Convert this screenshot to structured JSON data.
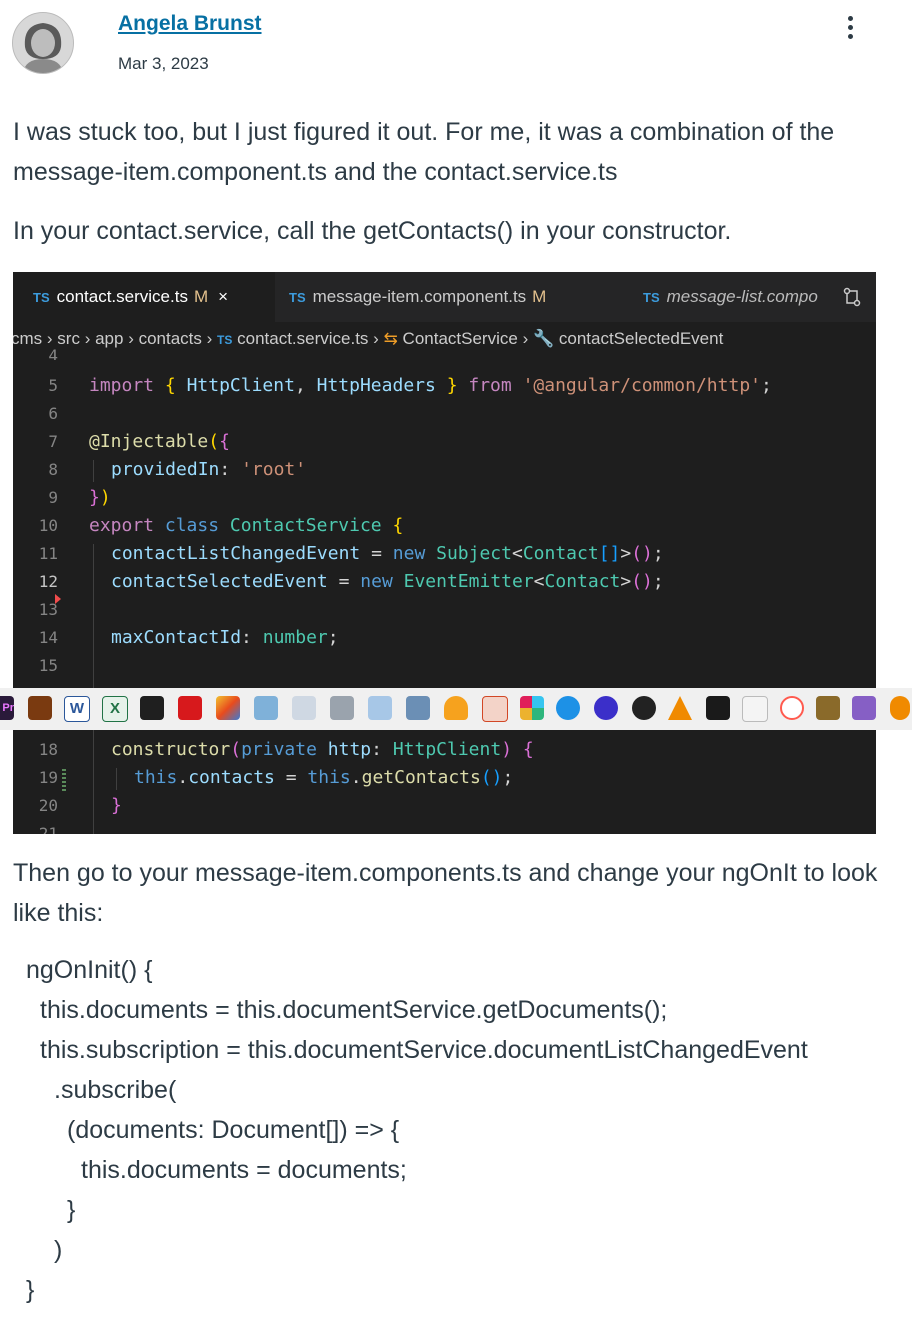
{
  "post": {
    "author": "Angela Brunst",
    "date": "Mar 3, 2023",
    "p1": "I was stuck too, but I just figured it out. For me, it was a combination of the message-item.component.ts and the contact.service.ts",
    "p2": "In your contact.service, call the getContacts() in your constructor.",
    "p3": "Then go to your message-item.components.ts and change your ngOnIt to look like this:"
  },
  "editor": {
    "tabs": [
      {
        "icon": "TS",
        "label": "contact.service.ts",
        "badge": "M",
        "close": "×"
      },
      {
        "icon": "TS",
        "label": "message-item.component.ts",
        "badge": "M"
      },
      {
        "icon": "TS",
        "label": "message-list.compo"
      }
    ],
    "crumbs": {
      "c1": "cms",
      "c2": "src",
      "c3": "app",
      "c4": "contacts",
      "ts": "TS",
      "c5": "contact.service.ts",
      "c6": "ContactService",
      "c7": "contactSelectedEvent"
    },
    "line_numbers": [
      "4",
      "5",
      "6",
      "7",
      "8",
      "9",
      "10",
      "11",
      "12",
      "13",
      "14",
      "15",
      "18",
      "19",
      "20",
      "21"
    ]
  },
  "code_block": {
    "l1": "ngOnInit() {",
    "l2": "this.documents = this.documentService.getDocuments();",
    "l3": "this.subscription = this.documentService.documentListChangedEvent",
    "l4": ".subscribe(",
    "l5": "(documents: Document[]) => {",
    "l6": "this.documents = documents;",
    "l7": "}",
    "l8": ")",
    "l9": "}"
  },
  "taskbar_icons": [
    "premiere-icon",
    "app-icon",
    "word-icon",
    "excel-icon",
    "acrobat-icon",
    "acrobat-red-icon",
    "paint-icon",
    "network-icon",
    "image-icon",
    "printer-icon",
    "window-icon",
    "folder-icon",
    "lightbulb-icon",
    "powerpoint-icon",
    "slack-icon",
    "docker-icon",
    "circle-icon",
    "obs-icon",
    "vlc-icon",
    "tool-icon",
    "arrow-icon",
    "browser-icon",
    "app2-icon",
    "visual-studio-icon",
    "blender-icon"
  ]
}
